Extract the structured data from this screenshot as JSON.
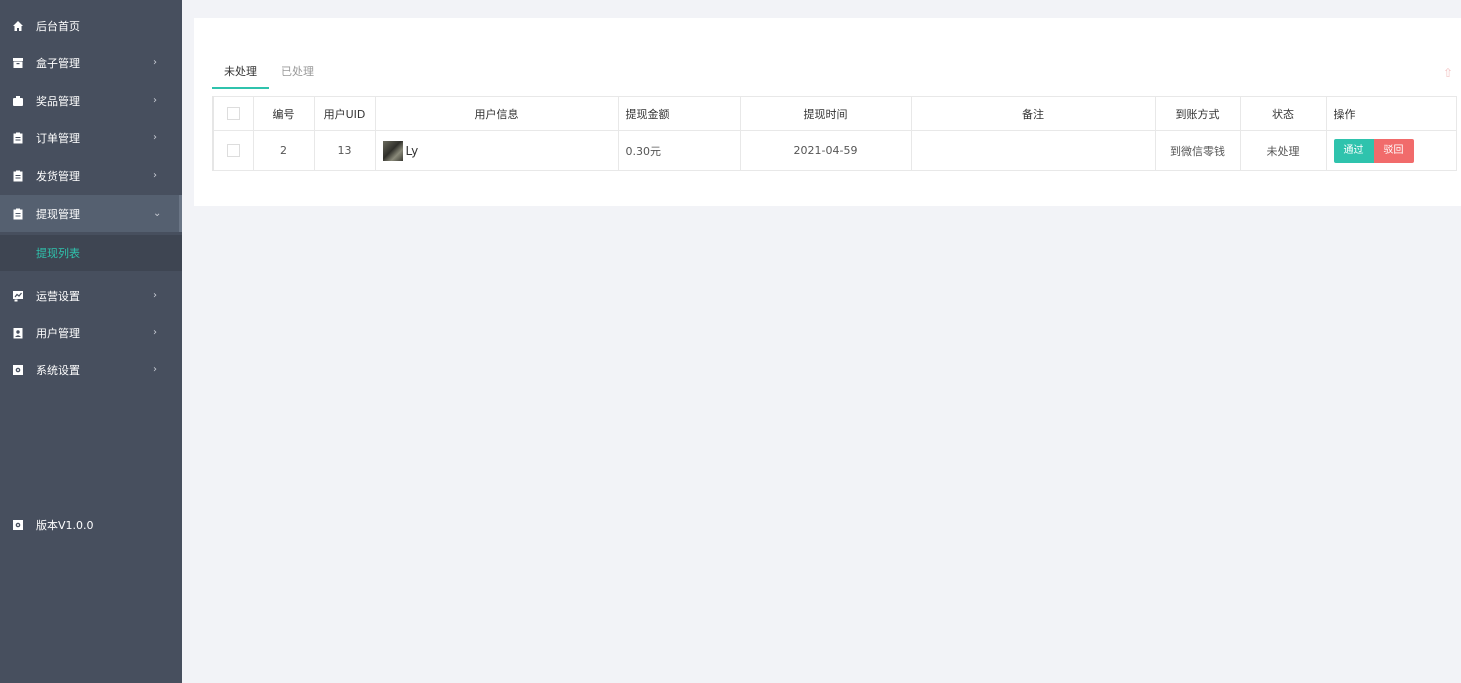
{
  "sidebar": {
    "items": [
      {
        "label": "后台首页",
        "icon": "home-icon",
        "has_arrow": false
      },
      {
        "label": "盒子管理",
        "icon": "box-icon",
        "has_arrow": true
      },
      {
        "label": "奖品管理",
        "icon": "gift-icon",
        "has_arrow": true
      },
      {
        "label": "订单管理",
        "icon": "clipboard-icon",
        "has_arrow": true
      },
      {
        "label": "发货管理",
        "icon": "clipboard-icon",
        "has_arrow": true
      },
      {
        "label": "提现管理",
        "icon": "clipboard-icon",
        "has_arrow": true,
        "expanded": true
      },
      {
        "label": "运营设置",
        "icon": "chart-icon",
        "has_arrow": true
      },
      {
        "label": "用户管理",
        "icon": "user-card-icon",
        "has_arrow": true
      },
      {
        "label": "系统设置",
        "icon": "settings-icon",
        "has_arrow": true
      }
    ],
    "sub_item": "提现列表",
    "version": "版本V1.0.0",
    "arrow_right": "›",
    "arrow_down": "⌄"
  },
  "tabs": [
    {
      "label": "未处理",
      "active": true
    },
    {
      "label": "已处理",
      "active": false
    }
  ],
  "table": {
    "headers": [
      "",
      "编号",
      "用户UID",
      "用户信息",
      "提现金额",
      "提现时间",
      "备注",
      "到账方式",
      "状态",
      "操作"
    ],
    "rows": [
      {
        "id": "2",
        "uid": "13",
        "user": "Ly",
        "amount": "0.30元",
        "time": "2021-04-59",
        "note": "",
        "method": "到微信零钱",
        "status": "未处理"
      }
    ],
    "actions": {
      "pass": "通过",
      "reject": "驳回"
    }
  },
  "colors": {
    "sidebar_bg": "#474f5e",
    "accent": "#2fc3ad",
    "danger": "#f16b6b",
    "page_bg": "#f2f3f7"
  }
}
